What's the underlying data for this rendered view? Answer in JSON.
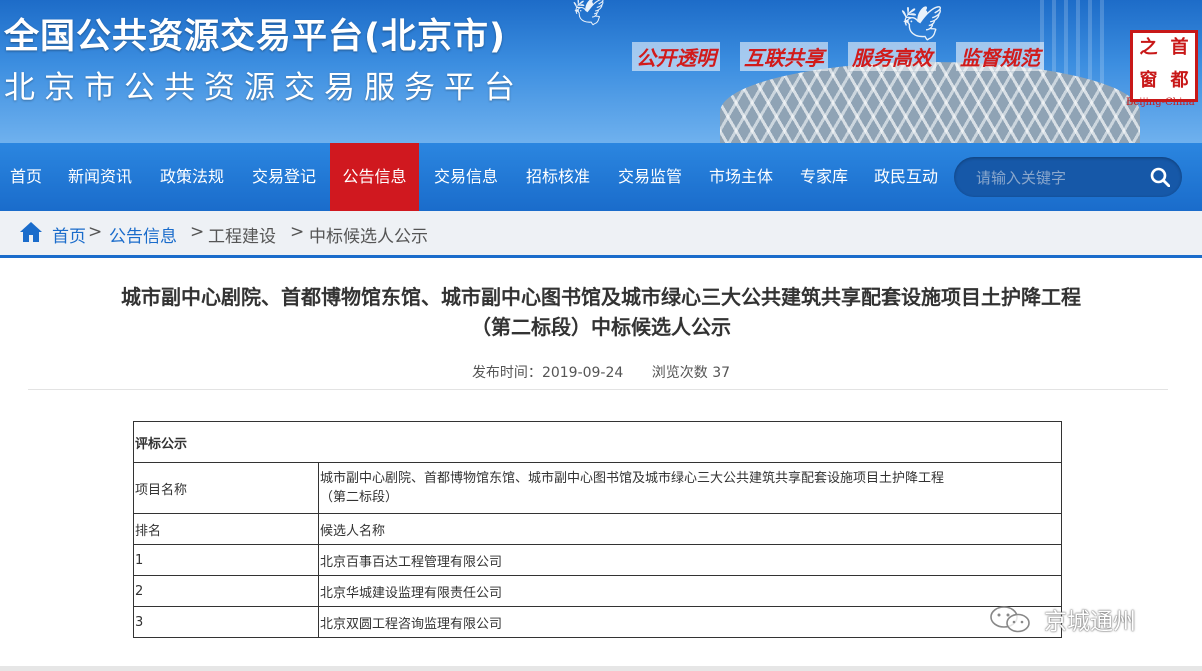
{
  "header": {
    "title_main": "全国公共资源交易平台(北京市)",
    "title_sub": "北京市公共资源交易服务平台",
    "slogans": [
      "公开透明",
      "互联共享",
      "服务高效",
      "监督规范"
    ],
    "seal_chars": [
      "之",
      "首",
      "窗",
      "都"
    ],
    "seal_caption": "Beijing-China"
  },
  "nav": {
    "items": [
      "首页",
      "新闻资讯",
      "政策法规",
      "交易登记",
      "公告信息",
      "交易信息",
      "招标核准",
      "交易监管",
      "市场主体",
      "专家库",
      "政民互动"
    ],
    "active_index": 4,
    "active_color": "#d0181f"
  },
  "search": {
    "placeholder": "请输入关键字",
    "icon": "search-icon"
  },
  "breadcrumb": {
    "items": [
      "首页",
      "公告信息",
      "工程建设",
      "中标候选人公示"
    ],
    "home_icon": "home-icon"
  },
  "article": {
    "title_line1": "城市副中心剧院、首都博物馆东馆、城市副中心图书馆及城市绿心三大公共建筑共享配套设施项目土护降工程",
    "title_line2": "（第二标段）中标候选人公示",
    "publish_label": "发布时间：",
    "publish_date": "2019-09-24",
    "views_label": "浏览次数",
    "views_count": "37"
  },
  "table": {
    "section_header": "评标公示",
    "project_label": "项目名称",
    "project_line1": "城市副中心剧院、首都博物馆东馆、城市副中心图书馆及城市绿心三大公共建筑共享配套设施项目土护降工程",
    "project_line2": "（第二标段）",
    "col_rank": "排名",
    "col_candidate": "候选人名称",
    "rows": [
      {
        "rank": "1",
        "name": "北京百事百达工程管理有限公司"
      },
      {
        "rank": "2",
        "name": "北京华城建设监理有限责任公司"
      },
      {
        "rank": "3",
        "name": "北京双圆工程咨询监理有限公司"
      }
    ]
  },
  "watermark": {
    "text": "京城通州",
    "icon": "wechat-icon"
  }
}
